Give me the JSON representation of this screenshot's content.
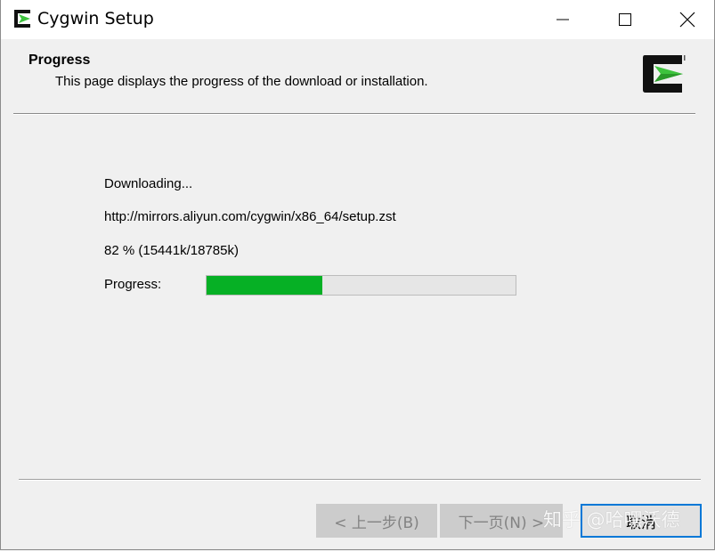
{
  "window": {
    "title": "Cygwin Setup",
    "controls": {
      "minimize_icon": "minimize-icon",
      "maximize_icon": "maximize-icon",
      "close_icon": "close-icon"
    }
  },
  "header": {
    "title": "Progress",
    "description": "This page displays the progress of the download or installation.",
    "logo_icon": "cygwin-logo-icon"
  },
  "body": {
    "status": "Downloading...",
    "url": "http://mirrors.aliyun.com/cygwin/x86_64/setup.zst",
    "percent_line": "82 %  (15441k/18785k)",
    "progress_label": "Progress:",
    "progress_fraction": 0.375,
    "progress_color": "#06b025"
  },
  "buttons": {
    "back_label": "< 上一步(B)",
    "next_label": "下一页(N) >",
    "cancel_label": "取消"
  },
  "watermark": "知乎 @哈嘿沃德",
  "colors": {
    "accent": "#0078d7",
    "cygwin_green": "#3ec33e"
  }
}
